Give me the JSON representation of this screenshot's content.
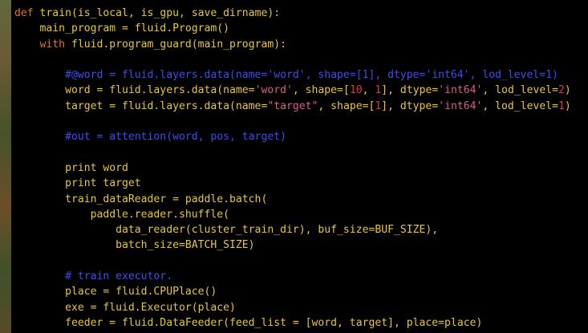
{
  "colors": {
    "keyword": "#d9772a",
    "text": "#e6c63c",
    "number": "#d83a3a",
    "string": "#d85f88",
    "comment": "#3b4ef0",
    "background": "#000000"
  },
  "code": {
    "lines": [
      [
        {
          "t": "kw",
          "v": "def"
        },
        {
          "t": "txt",
          "v": " train(is_local, is_gpu, save_dirname):"
        }
      ],
      [
        {
          "t": "txt",
          "v": "    main_program = fluid.Program()"
        }
      ],
      [
        {
          "t": "kw",
          "v": "    with"
        },
        {
          "t": "txt",
          "v": " fluid.program_guard(main_program):"
        }
      ],
      [],
      [
        {
          "t": "cmt",
          "v": "        #@word = fluid.layers.data(name='word', shape=[1], dtype='int64', lod_level=1)"
        }
      ],
      [
        {
          "t": "txt",
          "v": "        word = fluid.layers.data(name="
        },
        {
          "t": "str",
          "v": "'word'"
        },
        {
          "t": "txt",
          "v": ", shape=["
        },
        {
          "t": "num",
          "v": "10"
        },
        {
          "t": "txt",
          "v": ", "
        },
        {
          "t": "num",
          "v": "1"
        },
        {
          "t": "txt",
          "v": "], dtype="
        },
        {
          "t": "str",
          "v": "'int64'"
        },
        {
          "t": "txt",
          "v": ", lod_level="
        },
        {
          "t": "num",
          "v": "2"
        },
        {
          "t": "txt",
          "v": ")"
        }
      ],
      [
        {
          "t": "txt",
          "v": "        target = fluid.layers.data(name="
        },
        {
          "t": "str",
          "v": "\"target\""
        },
        {
          "t": "txt",
          "v": ", shape=["
        },
        {
          "t": "num",
          "v": "1"
        },
        {
          "t": "txt",
          "v": "], dtype="
        },
        {
          "t": "str",
          "v": "'int64'"
        },
        {
          "t": "txt",
          "v": ", lod_level="
        },
        {
          "t": "num",
          "v": "1"
        },
        {
          "t": "txt",
          "v": ")"
        }
      ],
      [],
      [
        {
          "t": "cmt",
          "v": "        #out = attention(word, pos, target)"
        }
      ],
      [],
      [
        {
          "t": "txt",
          "v": "        print word"
        }
      ],
      [
        {
          "t": "txt",
          "v": "        print target"
        }
      ],
      [
        {
          "t": "txt",
          "v": "        train_dataReader = paddle.batch("
        }
      ],
      [
        {
          "t": "txt",
          "v": "            paddle.reader.shuffle("
        }
      ],
      [
        {
          "t": "txt",
          "v": "                data_reader(cluster_train_dir), buf_size=BUF_SIZE),"
        }
      ],
      [
        {
          "t": "txt",
          "v": "                batch_size=BATCH_SIZE)"
        }
      ],
      [],
      [
        {
          "t": "cmt",
          "v": "        # train executor."
        }
      ],
      [
        {
          "t": "txt",
          "v": "        place = fluid.CPUPlace()"
        }
      ],
      [
        {
          "t": "txt",
          "v": "        exe = fluid.Executor(place)"
        }
      ],
      [
        {
          "t": "txt",
          "v": "        feeder = fluid.DataFeeder(feed_list = [word, target], place=place)"
        }
      ]
    ]
  }
}
